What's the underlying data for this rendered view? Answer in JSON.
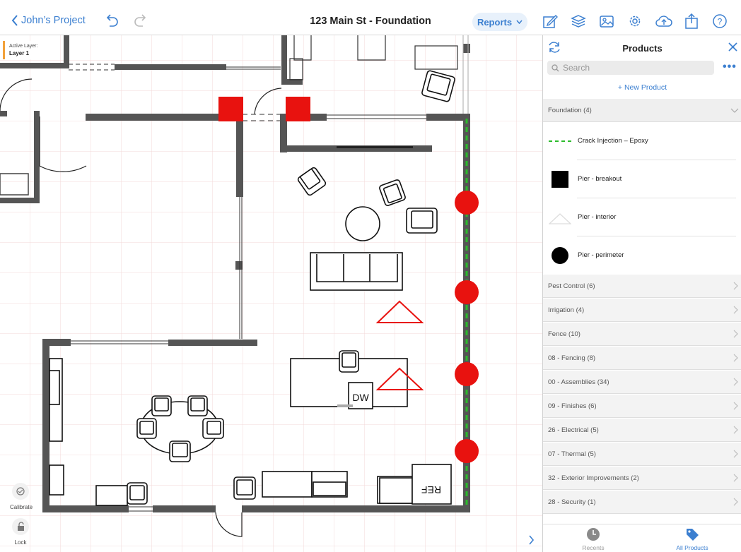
{
  "header": {
    "back_label": "John’s Project",
    "title": "123 Main St - Foundation",
    "reports_label": "Reports"
  },
  "canvas": {
    "active_layer_label": "Active Layer:",
    "active_layer_name": "Layer 1",
    "dishwasher_label": "DW",
    "fridge_label": "REF",
    "calibrate_label": "Calibrate",
    "lock_label": "Lock",
    "colors": {
      "wall": "#555555",
      "pier_red": "#e8120f",
      "epoxy_green": "#2bbb2b",
      "grid": "#f3d8d8"
    }
  },
  "panel": {
    "title": "Products",
    "search_placeholder": "Search",
    "new_product": "+ New Product",
    "expanded_category": "Foundation (4)",
    "products": [
      {
        "label": "Crack Injection – Epoxy",
        "symbol": "green-dashed-line"
      },
      {
        "label": "Pier - breakout",
        "symbol": "black-square"
      },
      {
        "label": "Pier - interior",
        "symbol": "outline-triangle"
      },
      {
        "label": "Pier - perimeter",
        "symbol": "black-circle"
      }
    ],
    "categories": [
      "Pest Control (6)",
      "Irrigation (4)",
      "Fence (10)",
      "08 - Fencing (8)",
      "00 - Assemblies (34)",
      "09 - Finishes (6)",
      "26 - Electrical (5)",
      "07 - Thermal (5)",
      "32 - Exterior Improvements (2)",
      "28 - Security (1)"
    ],
    "tabs": [
      {
        "label": "Recents",
        "icon": "clock-icon",
        "active": false
      },
      {
        "label": "All Products",
        "icon": "tag-icon",
        "active": true
      }
    ],
    "accent_color": "#3b7fd0"
  }
}
